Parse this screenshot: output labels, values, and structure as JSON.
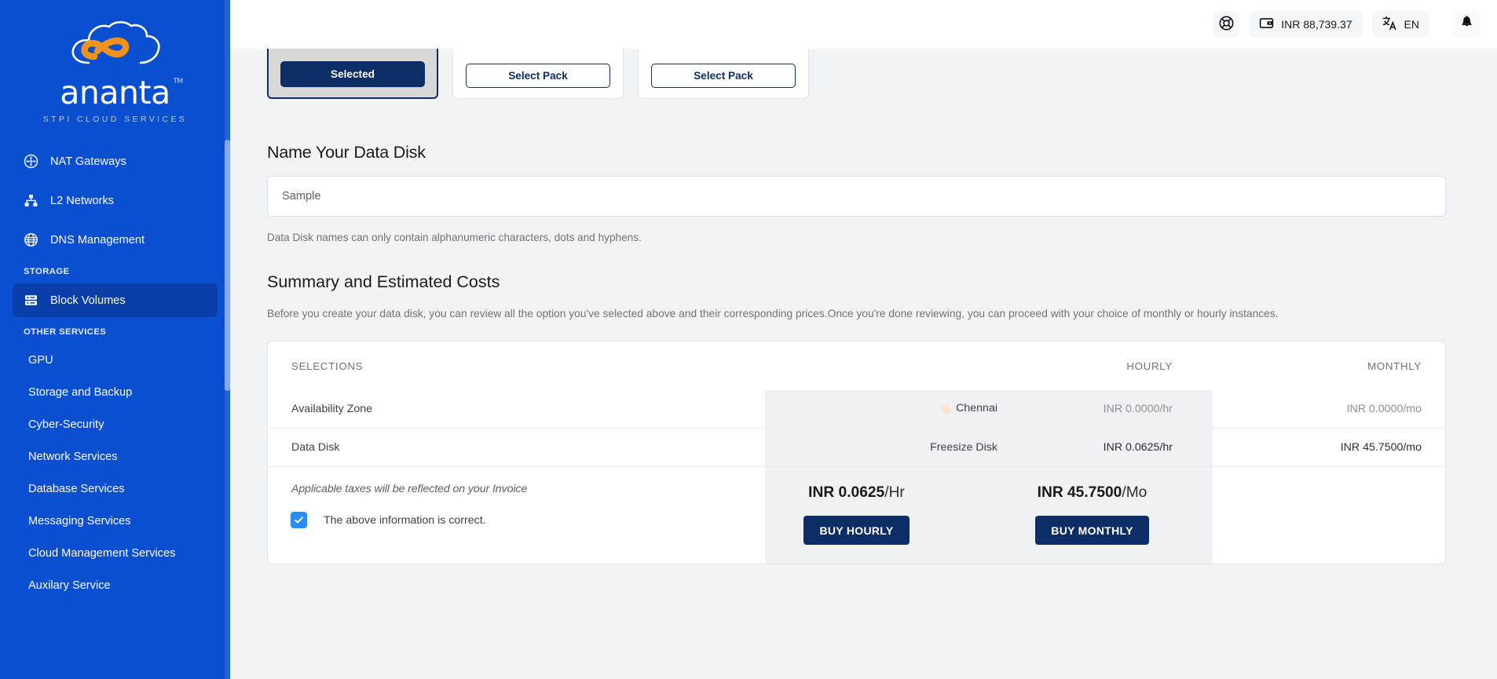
{
  "brand": {
    "word": "ananta",
    "tm": "TM",
    "tagline": "STPI CLOUD SERVICES",
    "logo_icon": "infinity-cloud-logo",
    "primary": "#0b4fd1",
    "accent": "#f0921e",
    "navy": "#0d2d66"
  },
  "sidebar": {
    "items": [
      {
        "label": "NAT Gateways",
        "icon": "nat-gateway-icon",
        "selected": false
      },
      {
        "label": "L2 Networks",
        "icon": "network-hierarchy-icon",
        "selected": false
      },
      {
        "label": "DNS Management",
        "icon": "globe-icon",
        "selected": false
      }
    ],
    "sections": [
      {
        "title": "STORAGE",
        "items": [
          {
            "label": "Block Volumes",
            "icon": "server-stack-icon",
            "selected": true
          }
        ]
      },
      {
        "title": "OTHER SERVICES",
        "items": [
          {
            "label": "GPU",
            "selected": false
          },
          {
            "label": "Storage and Backup",
            "selected": false
          },
          {
            "label": "Cyber-Security",
            "selected": false
          },
          {
            "label": "Network Services",
            "selected": false
          },
          {
            "label": "Database Services",
            "selected": false
          },
          {
            "label": "Messaging Services",
            "selected": false
          },
          {
            "label": "Cloud Management Services",
            "selected": false
          },
          {
            "label": "Auxilary Service",
            "selected": false
          }
        ]
      }
    ]
  },
  "topbar": {
    "support_icon": "lifebuoy-icon",
    "wallet_icon": "wallet-icon",
    "wallet_balance": "INR 88,739.37",
    "language_icon": "translate-icon",
    "language": "EN",
    "notification_icon": "bell-icon"
  },
  "packs": [
    {
      "label": "Selected",
      "state": "selected"
    },
    {
      "label": "Select Pack",
      "state": "default"
    },
    {
      "label": "Select Pack",
      "state": "default"
    }
  ],
  "disk_name": {
    "heading": "Name Your Data Disk",
    "placeholder": "Sample",
    "value": "",
    "hint": "Data Disk names can only contain alphanumeric characters, dots and hyphens."
  },
  "summary": {
    "heading": "Summary and Estimated Costs",
    "description": "Before you create your data disk, you can review all the option you've selected above and their corresponding prices.Once you're done reviewing, you can proceed with your choice of monthly or hourly instances.",
    "columns": [
      "SELECTIONS",
      "HOURLY",
      "MONTHLY"
    ],
    "rows": [
      {
        "label": "Availability Zone",
        "value": "Chennai",
        "value_icon": "region-flag-icon",
        "hourly": "INR 0.0000/hr",
        "monthly": "INR 0.0000/mo",
        "muted": true
      },
      {
        "label": "Data Disk",
        "value": "Freesize Disk",
        "value_icon": "",
        "hourly": "INR 0.0625/hr",
        "monthly": "INR 45.7500/mo",
        "muted": false
      }
    ],
    "tax_note": "Applicable taxes will be reflected on your Invoice",
    "confirm_checkbox": {
      "label": "The above information is correct.",
      "checked": true,
      "color": "#2b8cf0"
    },
    "totals": {
      "hourly_amount": "INR 0.0625",
      "hourly_unit": "/Hr",
      "monthly_amount": "INR 45.7500",
      "monthly_unit": "/Mo",
      "buy_hourly_label": "BUY HOURLY",
      "buy_monthly_label": "BUY MONTHLY"
    }
  }
}
